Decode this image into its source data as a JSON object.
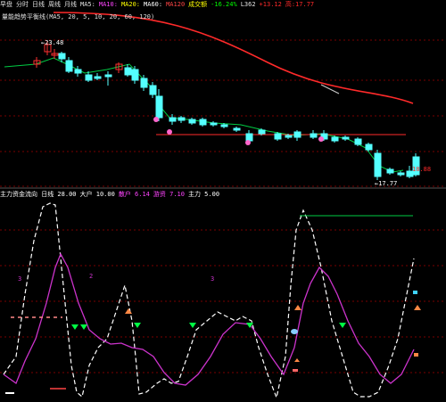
{
  "header": {
    "items": [
      {
        "text": "早盘",
        "color": "#e0e0e0"
      },
      {
        "text": "分时",
        "color": "#e0e0e0"
      },
      {
        "text": "日线",
        "color": "#e0e0e0"
      },
      {
        "text": "周线",
        "color": "#e0e0e0"
      },
      {
        "text": "月线",
        "color": "#e0e0e0"
      },
      {
        "text": "MA5:",
        "color": "#e0e0e0"
      },
      {
        "text": "MA10:",
        "color": "#ff44ff"
      },
      {
        "text": "MA20:",
        "color": "#ffff00"
      },
      {
        "text": "MA60:",
        "color": "#ffffff"
      },
      {
        "text": "MA120",
        "color": "#ff4444"
      },
      {
        "text": "成交额",
        "color": "#ffff00"
      },
      {
        "text": "-16.24%",
        "color": "#00ff00"
      },
      {
        "text": "L362",
        "color": "#e0e0e0"
      },
      {
        "text": "+13.12",
        "color": "#ff2a2a"
      },
      {
        "text": "高:17.77",
        "color": "#ff2a2a"
      }
    ]
  },
  "price_panel": {
    "title": "量能趋势平衡线(MA5, 20, 5, 10, 20, 60, 120)",
    "high_label": "←23.48",
    "low_label": "←17.77",
    "right_value": "18.88"
  },
  "indicator_panel": {
    "items": [
      {
        "text": "主力资金流向 日线 28.00",
        "color": "#ffffff"
      },
      {
        "text": "大户 10.00",
        "color": "#ffffff"
      },
      {
        "text": "散户 6.14",
        "color": "#ff44ff"
      },
      {
        "text": "游资 7.10",
        "color": "#ff44ff"
      },
      {
        "text": "主力 5.00",
        "color": "#ffffff"
      }
    ],
    "labels": [
      "3",
      "2",
      "3"
    ]
  },
  "colors": {
    "up": "#ff3030",
    "down": "#54ffff",
    "ma_short": "#ffffff",
    "ma_mid": "#ffff00",
    "ma_long": "#ff2a2a",
    "ma_green": "#00cc44",
    "osc_white": "#ffffff",
    "osc_magenta": "#cc33cc",
    "grid": "#7a0000"
  }
}
